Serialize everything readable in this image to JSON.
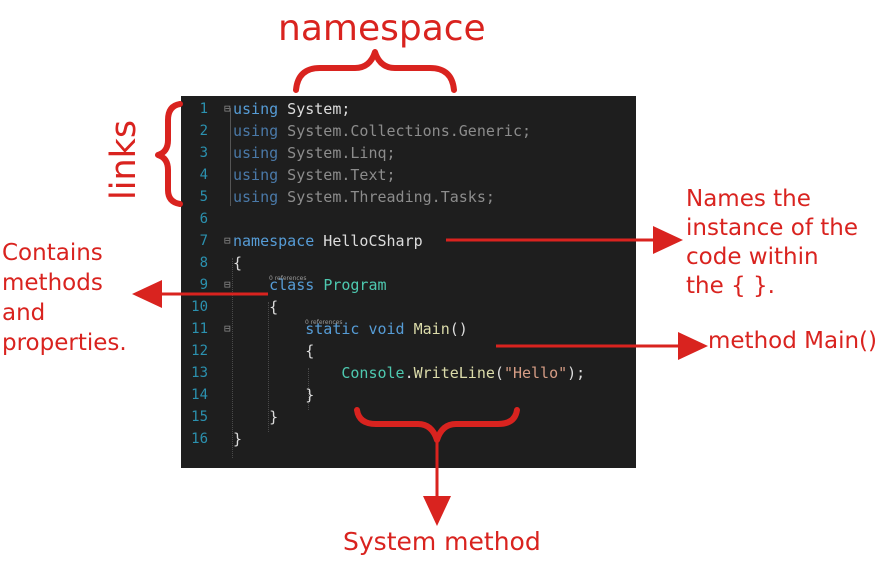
{
  "annotations": {
    "namespace": "namespace",
    "links": "links",
    "names_instance": "Names the\ninstance of the\ncode within\nthe { }.",
    "contains": "Contains\nmethods\nand\nproperties.",
    "method_main": "method Main()",
    "system_method": "System method"
  },
  "editor": {
    "lines": [
      {
        "num": "1",
        "fold": "⊟",
        "tokens": [
          {
            "t": "using",
            "c": "kw"
          },
          {
            "t": " System;",
            "c": "plain"
          }
        ]
      },
      {
        "num": "2",
        "fold": "",
        "tokens": [
          {
            "t": "using",
            "c": "kw-dim"
          },
          {
            "t": " System.Collections.Generic;",
            "c": "dim"
          }
        ]
      },
      {
        "num": "3",
        "fold": "",
        "tokens": [
          {
            "t": "using",
            "c": "kw-dim"
          },
          {
            "t": " System.Linq;",
            "c": "dim"
          }
        ]
      },
      {
        "num": "4",
        "fold": "",
        "tokens": [
          {
            "t": "using",
            "c": "kw-dim"
          },
          {
            "t": " System.Text;",
            "c": "dim"
          }
        ]
      },
      {
        "num": "5",
        "fold": "",
        "tokens": [
          {
            "t": "using",
            "c": "kw-dim"
          },
          {
            "t": " System.Threading.Tasks;",
            "c": "dim"
          }
        ]
      },
      {
        "num": "6",
        "fold": "",
        "tokens": []
      },
      {
        "num": "7",
        "fold": "⊟",
        "tokens": [
          {
            "t": "namespace",
            "c": "kw"
          },
          {
            "t": " HelloCSharp",
            "c": "plain"
          }
        ]
      },
      {
        "num": "8",
        "fold": "",
        "tokens": [
          {
            "t": "{",
            "c": "plain"
          }
        ]
      },
      {
        "num": "9",
        "fold": "⊟",
        "ref": "0 references",
        "tokens": [
          {
            "t": "    ",
            "c": "plain"
          },
          {
            "t": "class",
            "c": "kw"
          },
          {
            "t": " ",
            "c": "plain"
          },
          {
            "t": "Program",
            "c": "cls"
          }
        ]
      },
      {
        "num": "10",
        "fold": "",
        "tokens": [
          {
            "t": "    {",
            "c": "plain"
          }
        ]
      },
      {
        "num": "11",
        "fold": "⊟",
        "ref": "0 references",
        "tokens": [
          {
            "t": "        ",
            "c": "plain"
          },
          {
            "t": "static",
            "c": "kw"
          },
          {
            "t": " ",
            "c": "plain"
          },
          {
            "t": "void",
            "c": "kw"
          },
          {
            "t": " ",
            "c": "plain"
          },
          {
            "t": "Main",
            "c": "mth"
          },
          {
            "t": "()",
            "c": "plain"
          }
        ]
      },
      {
        "num": "12",
        "fold": "",
        "tokens": [
          {
            "t": "        {",
            "c": "plain"
          }
        ]
      },
      {
        "num": "13",
        "fold": "",
        "tokens": [
          {
            "t": "            ",
            "c": "plain"
          },
          {
            "t": "Console",
            "c": "cls"
          },
          {
            "t": ".",
            "c": "plain"
          },
          {
            "t": "WriteLine",
            "c": "mth"
          },
          {
            "t": "(",
            "c": "plain"
          },
          {
            "t": "\"Hello\"",
            "c": "str"
          },
          {
            "t": ");",
            "c": "plain"
          }
        ]
      },
      {
        "num": "14",
        "fold": "",
        "tokens": [
          {
            "t": "        }",
            "c": "plain"
          }
        ]
      },
      {
        "num": "15",
        "fold": "",
        "tokens": [
          {
            "t": "    }",
            "c": "plain"
          }
        ]
      },
      {
        "num": "16",
        "fold": "",
        "tokens": [
          {
            "t": "}",
            "c": "plain"
          }
        ]
      }
    ]
  },
  "colors": {
    "annotation": "#d9231f",
    "editor_bg": "#1e1e1e",
    "line_number": "#2b91af"
  }
}
